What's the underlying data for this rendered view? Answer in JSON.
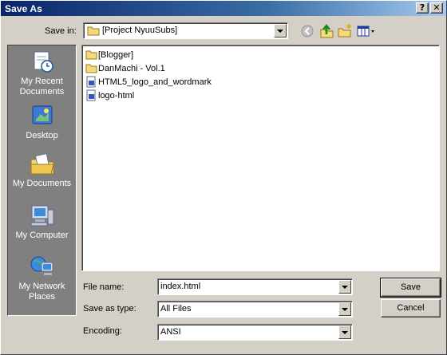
{
  "window": {
    "title": "Save As",
    "help_button": "?",
    "close_button": "✕"
  },
  "save_in": {
    "label": "Save in:",
    "value": "[Project NyuuSubs]"
  },
  "toolbar": {
    "icons": [
      "back-icon",
      "up-one-level-icon",
      "new-folder-icon",
      "view-menu-icon"
    ]
  },
  "places": [
    {
      "label": "My Recent Documents",
      "icon": "recent-documents-icon"
    },
    {
      "label": "Desktop",
      "icon": "desktop-icon"
    },
    {
      "label": "My Documents",
      "icon": "my-documents-icon"
    },
    {
      "label": "My Computer",
      "icon": "my-computer-icon"
    },
    {
      "label": "My Network Places",
      "icon": "network-places-icon"
    }
  ],
  "files": [
    {
      "name": "[Blogger]",
      "type": "folder"
    },
    {
      "name": "DanMachi - Vol.1",
      "type": "folder"
    },
    {
      "name": "HTML5_logo_and_wordmark",
      "type": "file"
    },
    {
      "name": "logo-html",
      "type": "file"
    }
  ],
  "form": {
    "file_name_label": "File name:",
    "file_name_value": "index.html",
    "save_as_type_label": "Save as type:",
    "save_as_type_value": "All Files",
    "encoding_label": "Encoding:",
    "encoding_value": "ANSI"
  },
  "buttons": {
    "save": "Save",
    "cancel": "Cancel"
  }
}
